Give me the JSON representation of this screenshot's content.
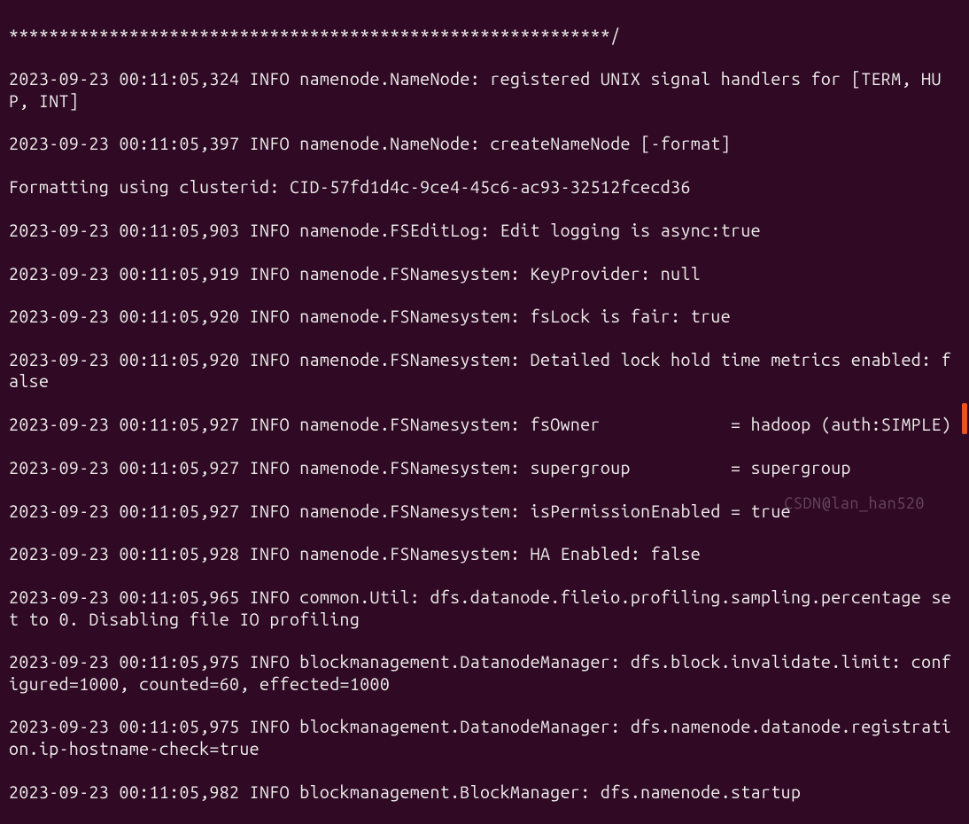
{
  "watermark_text": "CSDN@lan_han520",
  "log_lines": [
    "************************************************************/",
    "2023-09-23 00:11:05,324 INFO namenode.NameNode: registered UNIX signal handlers for [TERM, HUP, INT]",
    "2023-09-23 00:11:05,397 INFO namenode.NameNode: createNameNode [-format]",
    "Formatting using clusterid: CID-57fd1d4c-9ce4-45c6-ac93-32512fcecd36",
    "2023-09-23 00:11:05,903 INFO namenode.FSEditLog: Edit logging is async:true",
    "2023-09-23 00:11:05,919 INFO namenode.FSNamesystem: KeyProvider: null",
    "2023-09-23 00:11:05,920 INFO namenode.FSNamesystem: fsLock is fair: true",
    "2023-09-23 00:11:05,920 INFO namenode.FSNamesystem: Detailed lock hold time metrics enabled: false",
    "2023-09-23 00:11:05,927 INFO namenode.FSNamesystem: fsOwner             = hadoop (auth:SIMPLE)",
    "2023-09-23 00:11:05,927 INFO namenode.FSNamesystem: supergroup          = supergroup",
    "2023-09-23 00:11:05,927 INFO namenode.FSNamesystem: isPermissionEnabled = true",
    "2023-09-23 00:11:05,928 INFO namenode.FSNamesystem: HA Enabled: false",
    "2023-09-23 00:11:05,965 INFO common.Util: dfs.datanode.fileio.profiling.sampling.percentage set to 0. Disabling file IO profiling",
    "2023-09-23 00:11:05,975 INFO blockmanagement.DatanodeManager: dfs.block.invalidate.limit: configured=1000, counted=60, effected=1000",
    "2023-09-23 00:11:05,975 INFO blockmanagement.DatanodeManager: dfs.namenode.datanode.registration.ip-hostname-check=true",
    "2023-09-23 00:11:05,982 INFO blockmanagement.BlockManager: dfs.namenode.startup"
  ]
}
